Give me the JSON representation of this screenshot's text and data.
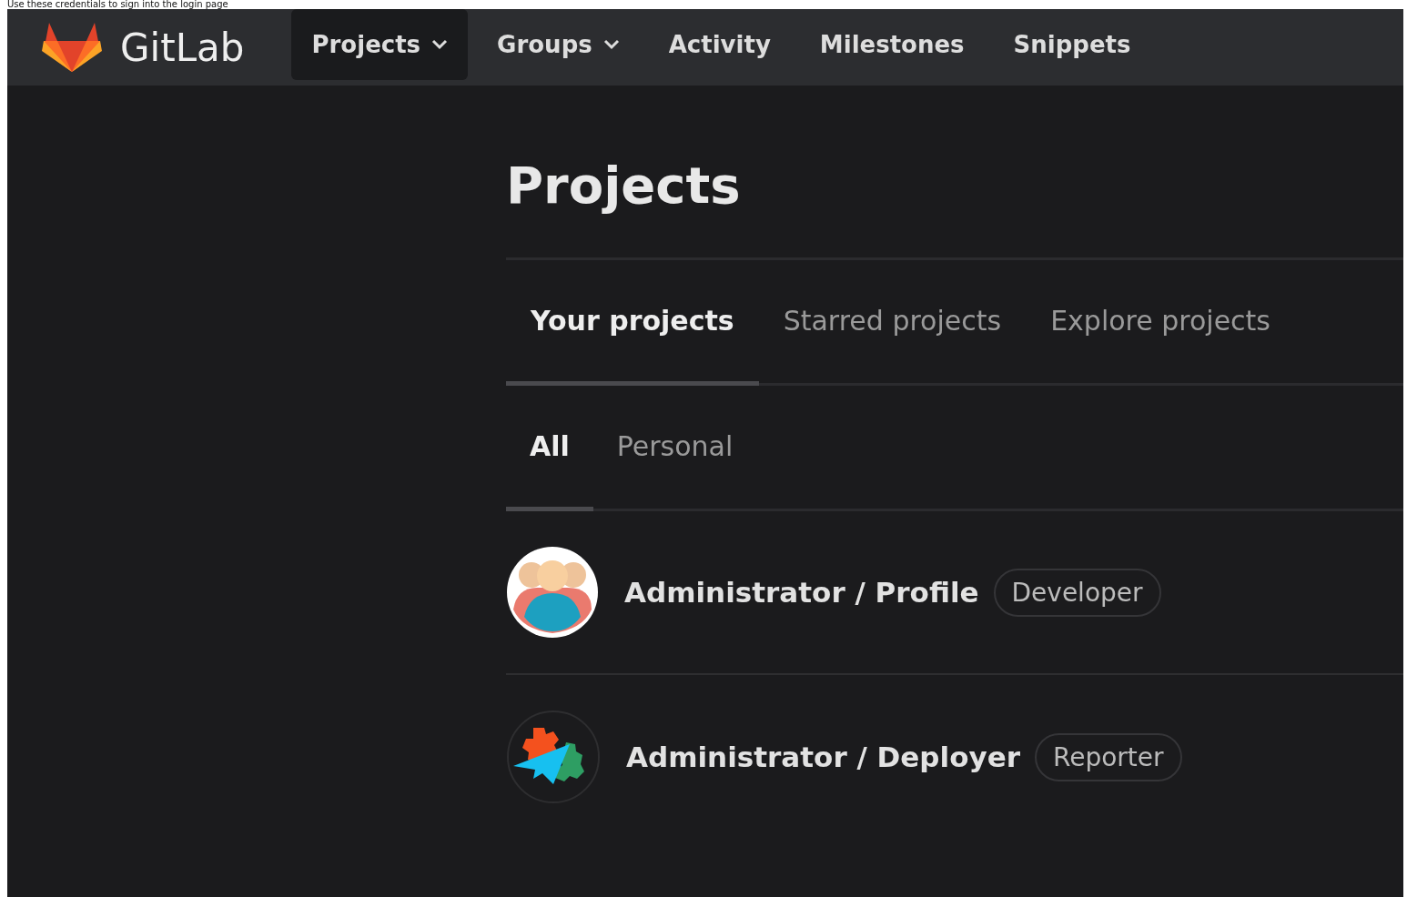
{
  "caption": "Use these credentials to sign into the login page",
  "navbar": {
    "brand": "GitLab",
    "items": [
      {
        "label": "Projects",
        "dropdown": true,
        "selected": true
      },
      {
        "label": "Groups",
        "dropdown": true,
        "selected": false
      },
      {
        "label": "Activity",
        "dropdown": false,
        "selected": false
      },
      {
        "label": "Milestones",
        "dropdown": false,
        "selected": false
      },
      {
        "label": "Snippets",
        "dropdown": false,
        "selected": false
      }
    ]
  },
  "page_title": "Projects",
  "tabs": [
    {
      "label": "Your projects",
      "selected": true
    },
    {
      "label": "Starred projects",
      "selected": false
    },
    {
      "label": "Explore projects",
      "selected": false
    }
  ],
  "filters": [
    {
      "label": "All",
      "selected": true
    },
    {
      "label": "Personal",
      "selected": false
    }
  ],
  "projects": [
    {
      "name": "Administrator / Profile",
      "role": "Developer",
      "kind": "people"
    },
    {
      "name": "Administrator / Deployer",
      "role": "Reporter",
      "kind": "gears"
    }
  ]
}
